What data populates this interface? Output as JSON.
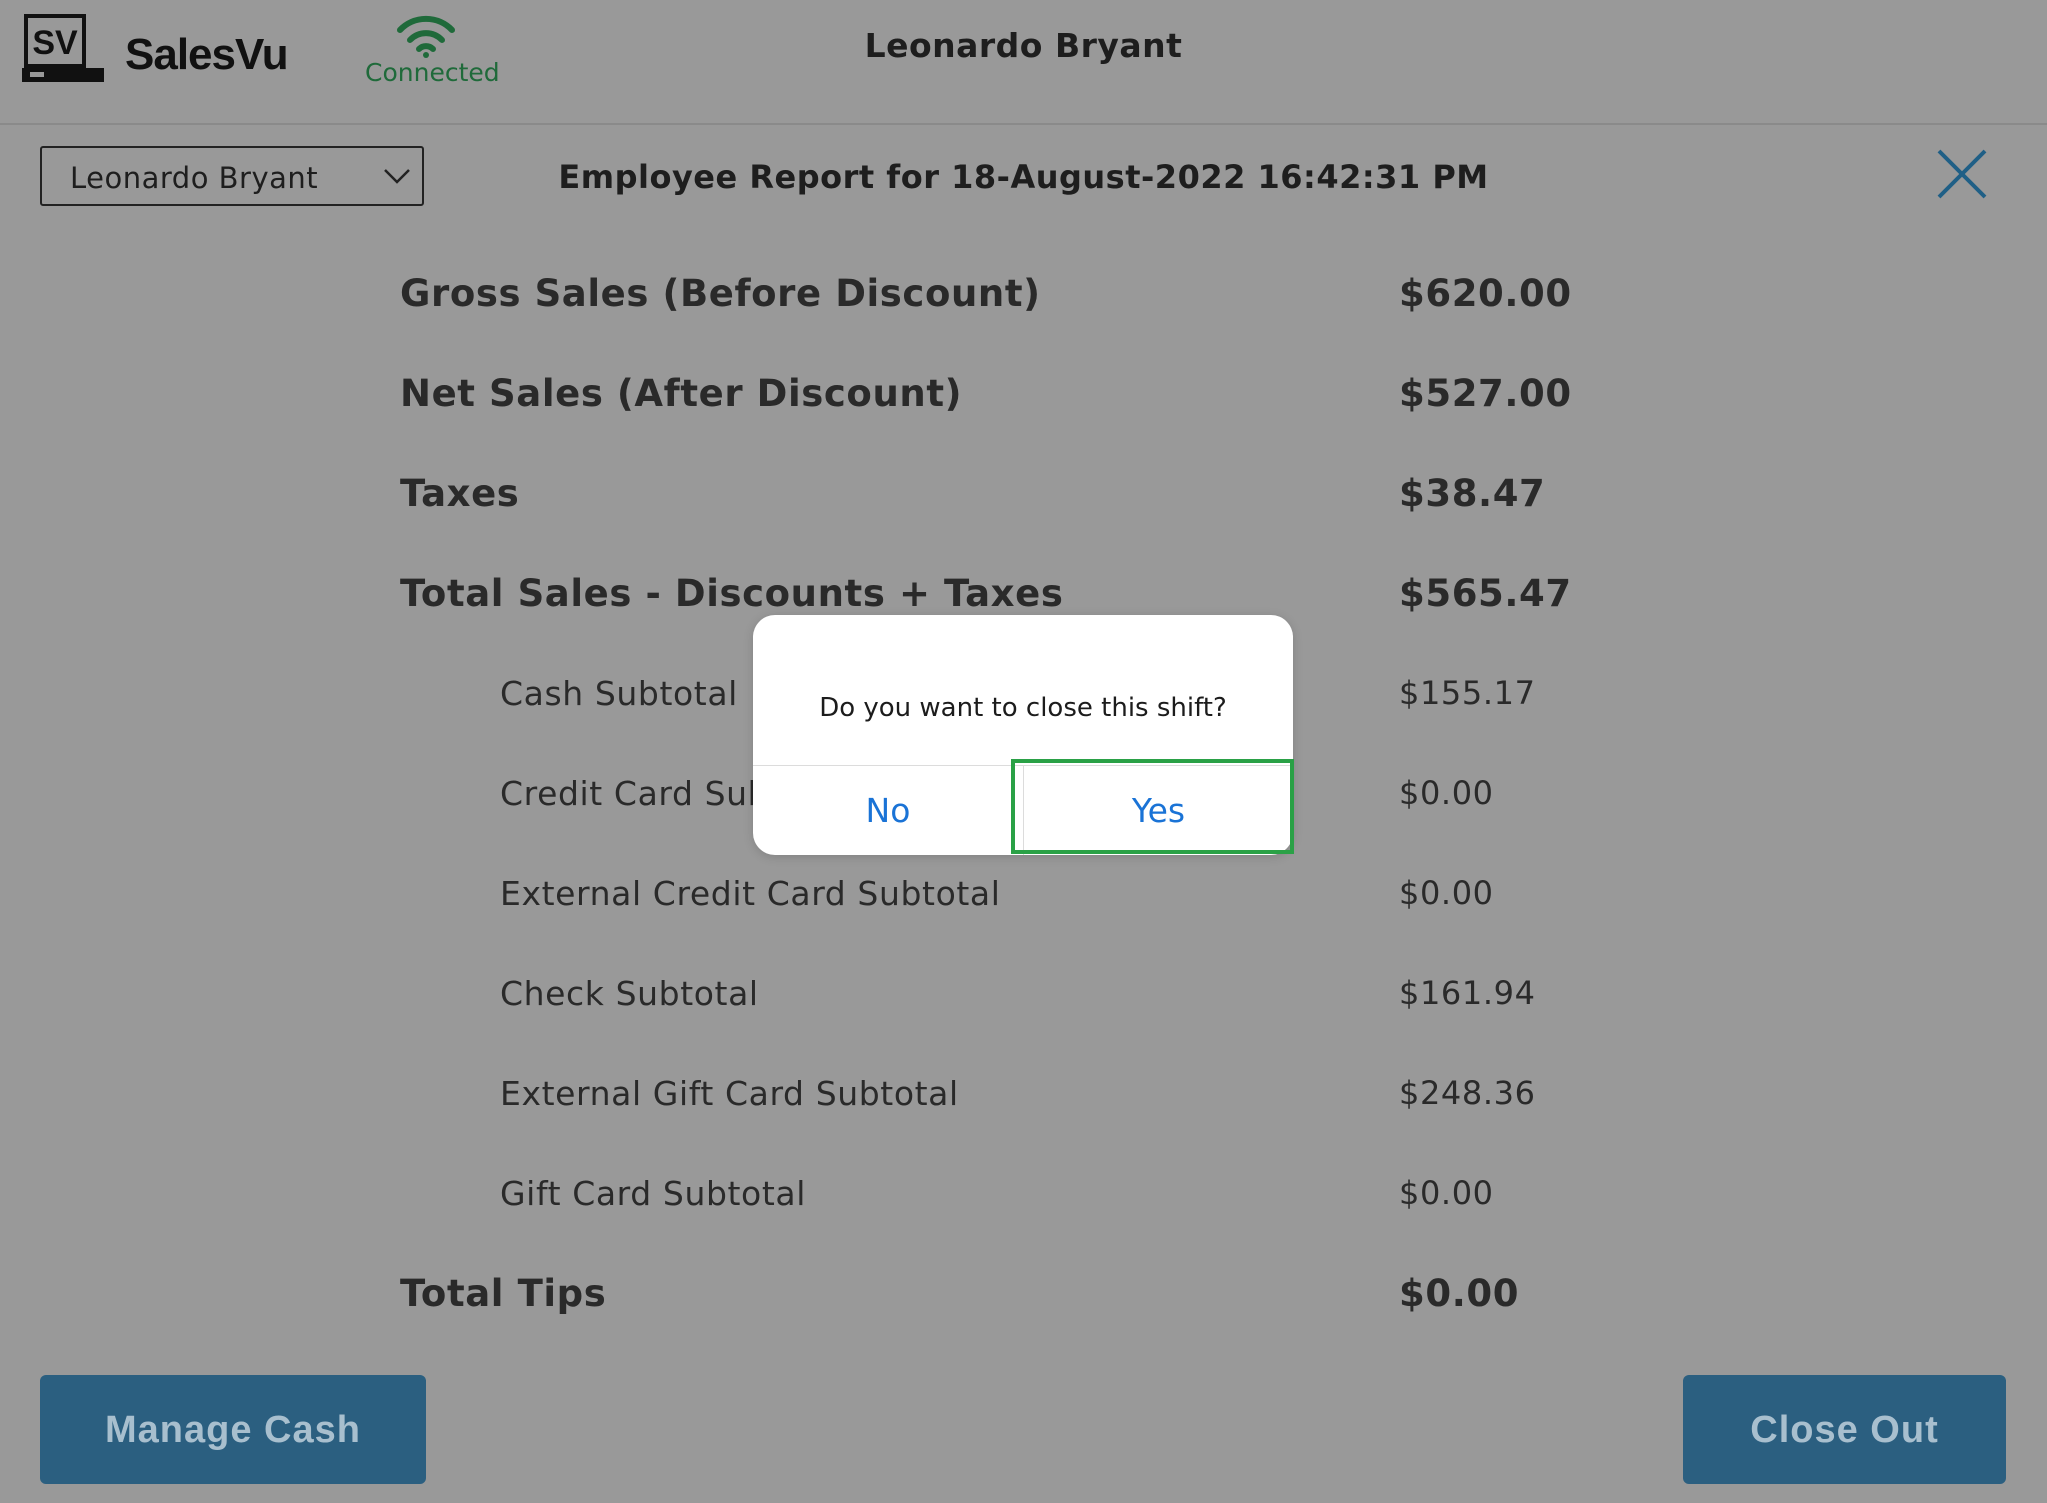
{
  "header": {
    "brand": "SalesVu",
    "logo_text": "SV",
    "connection_status": "Connected",
    "user_name": "Leonardo Bryant"
  },
  "toolbar": {
    "employee_select_value": "Leonardo Bryant",
    "report_title": "Employee Report for 18-August-2022 16:42:31 PM"
  },
  "report": {
    "rows": [
      {
        "label": "Gross Sales (Before Discount)",
        "value": "$620.00",
        "level": "main"
      },
      {
        "label": "Net Sales (After Discount)",
        "value": "$527.00",
        "level": "main"
      },
      {
        "label": "Taxes",
        "value": "$38.47",
        "level": "main"
      },
      {
        "label": "Total Sales - Discounts + Taxes",
        "value": "$565.47",
        "level": "main"
      },
      {
        "label": "Cash Subtotal",
        "value": "$155.17",
        "level": "sub"
      },
      {
        "label": "Credit Card Subtotal",
        "value": "$0.00",
        "level": "sub"
      },
      {
        "label": "External Credit Card Subtotal",
        "value": "$0.00",
        "level": "sub"
      },
      {
        "label": "Check Subtotal",
        "value": "$161.94",
        "level": "sub"
      },
      {
        "label": "External Gift Card Subtotal",
        "value": "$248.36",
        "level": "sub"
      },
      {
        "label": "Gift Card Subtotal",
        "value": "$0.00",
        "level": "sub"
      },
      {
        "label": "Total Tips",
        "value": "$0.00",
        "level": "main"
      }
    ]
  },
  "footer": {
    "manage_cash_label": "Manage Cash",
    "close_out_label": "Close Out"
  },
  "dialog": {
    "message": "Do you want to close this shift?",
    "no_label": "No",
    "yes_label": "Yes"
  },
  "icons": {
    "logo": "salesvu-register-icon",
    "wifi": "wifi-icon",
    "dropdown": "chevron-down-icon",
    "close": "close-icon"
  },
  "colors": {
    "background": "#999999",
    "button_bg": "#2b5f80",
    "connected": "#1f6a3a",
    "dialog_action": "#1a73d6",
    "highlight": "#2aa146"
  }
}
